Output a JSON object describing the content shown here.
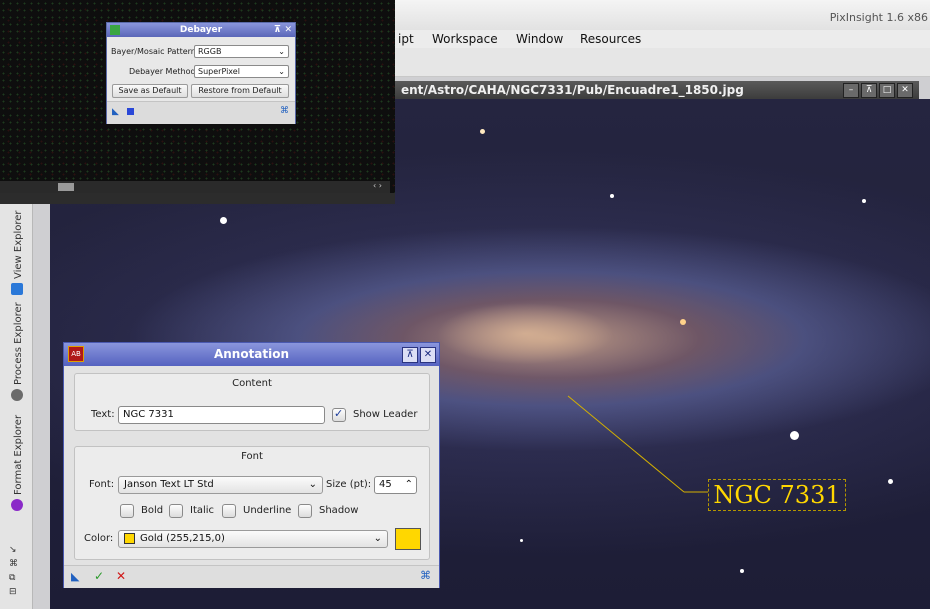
{
  "app": {
    "title": "PixInsight 1.6 x86",
    "menus": [
      "ipt",
      "Workspace",
      "Window",
      "Resources"
    ]
  },
  "image_window": {
    "title": "ent/Astro/CAHA/NGC7331/Pub/Encuadre1_1850.jpg",
    "annotation_label": "NGC 7331",
    "annotation_color": "#ffd700"
  },
  "dock": {
    "tabs": [
      "View Explorer",
      "Process Explorer",
      "Format Explorer"
    ]
  },
  "debayer": {
    "title": "Debayer",
    "pattern_label": "Bayer/Mosaic Pattern:",
    "pattern_value": "RGGB",
    "method_label": "Debayer Method:",
    "method_value": "SuperPixel",
    "save_default": "Save as Default",
    "restore_default": "Restore from Default"
  },
  "annotation": {
    "title": "Annotation",
    "content_group": "Content",
    "text_label": "Text:",
    "text_value": "NGC 7331",
    "show_leader_label": "Show Leader",
    "show_leader_checked": true,
    "font_group": "Font",
    "font_label": "Font:",
    "font_value": "Janson Text LT Std",
    "size_label": "Size (pt):",
    "size_value": "45",
    "bold_label": "Bold",
    "italic_label": "Italic",
    "underline_label": "Underline",
    "shadow_label": "Shadow",
    "color_label": "Color:",
    "color_value": "Gold (255,215,0)",
    "color_hex": "#ffd700"
  }
}
